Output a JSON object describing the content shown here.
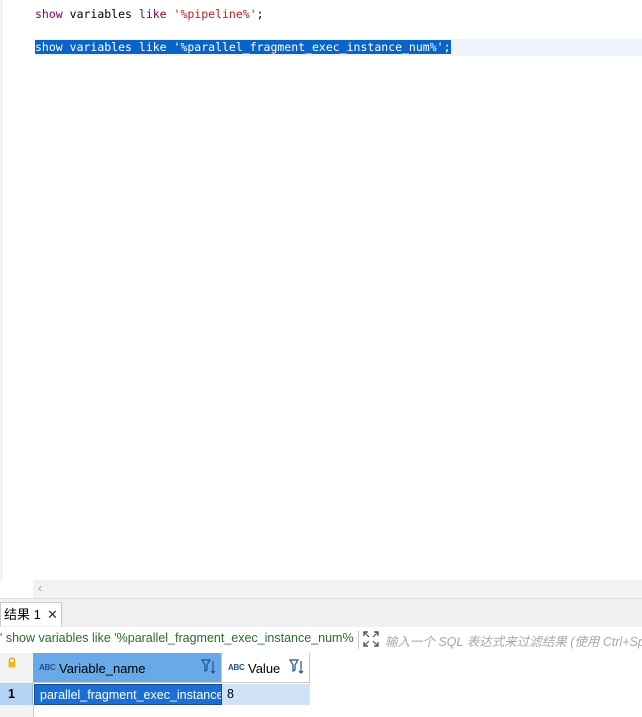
{
  "editor": {
    "line1": {
      "kw1": "show",
      "id1": "variables",
      "kw2": "like",
      "str": "'%pipeline%'",
      "end": ";"
    },
    "line2": {
      "kw1": "show",
      "id1": "variables",
      "kw2": "like",
      "str": "'%parallel_fragment_exec_instance_num%'",
      "end": ";"
    }
  },
  "results": {
    "tab_label": "结果 1",
    "filter_query": "' show variables like '%parallel_fragment_exec_instance_num%",
    "filter_placeholder": "输入一个 SQL 表达式来过滤结果 (使用 Ctrl+Spa",
    "columns": [
      {
        "type_badge": "ABC",
        "name": "Variable_name"
      },
      {
        "type_badge": "ABC",
        "name": "Value"
      }
    ],
    "rows": [
      {
        "num": "1",
        "cells": [
          "parallel_fragment_exec_instance_num",
          "8"
        ]
      }
    ]
  },
  "icons": {
    "close": "close-icon",
    "expand": "expand-icon",
    "lock": "lock-icon",
    "filter_sort": "filter-sort-icon",
    "scroll_left": "chevron-left-icon"
  },
  "colors": {
    "selection": "#0a64c8",
    "keyword": "#7f0055",
    "string": "#b22222",
    "header_selected": "#6aa9e8",
    "cell_selected": "#1a6fd4"
  }
}
